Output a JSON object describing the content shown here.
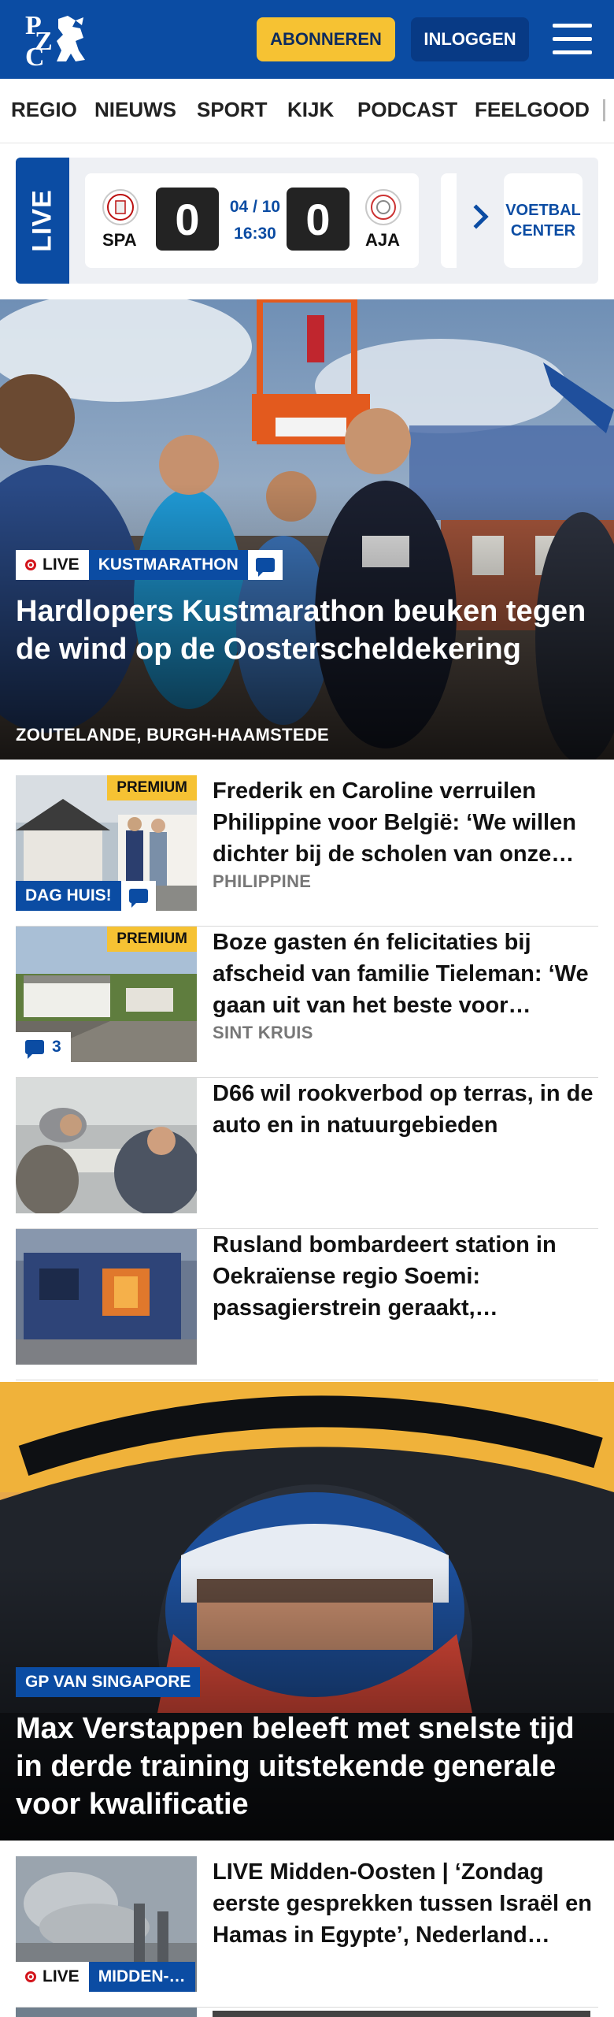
{
  "header": {
    "logo": [
      "P",
      "Z",
      "C"
    ],
    "subscribe_label": "ABONNEREN",
    "login_label": "INLOGGEN",
    "brand_color": "#0b4ca3",
    "accent_color": "#f6c233"
  },
  "nav": {
    "items": [
      "REGIO",
      "NIEUWS",
      "SPORT",
      "KIJK",
      "PODCAST",
      "FEELGOOD"
    ]
  },
  "livebar": {
    "live_label": "LIVE",
    "match": {
      "home": "SPA",
      "away": "AJA",
      "home_score": "0",
      "away_score": "0",
      "date": "04 / 10",
      "time": "16:30"
    },
    "voetbal_center_label": "VOETBAL\nCENTER"
  },
  "hero1": {
    "live_label": "LIVE",
    "category": "KUSTMARATHON",
    "title": "Hardlopers Kustmarathon beuken tegen de wind op de Oosterscheldeke­ring",
    "subtitle": "ZOUTELANDE, BURGH-HAAMSTEDE"
  },
  "articles": [
    {
      "title": "Frederik en Caroline verruilen Philippine voor België: ‘We willen dichter bij de scholen van onze…",
      "location": "PHILIPPINE",
      "premium": "PREMIUM",
      "label": "DAG HUIS!"
    },
    {
      "title": "Boze gasten én felicitaties bij afscheid van familie Tieleman: ‘We gaan uit van het beste voor…",
      "location": "SINT KRUIS",
      "premium": "PREMIUM",
      "comments": "3"
    },
    {
      "title": "D66 wil rookverbod op terras, in de auto en in natuurgebieden"
    },
    {
      "title": "Rusland bombardeert station in Oekraïense regio Soemi: passagierstrein geraakt,…"
    }
  ],
  "hero2": {
    "category": "GP VAN SINGAPORE",
    "title": "Max Verstappen beleeft met snelste tijd in derde training uitstekende generale voor kwalificatie"
  },
  "article_live": {
    "title": "LIVE Midden-Oosten | ‘Zondag eerste gesprekken tussen Israël en Hamas in Egypte’, Nederland…",
    "live_label": "LIVE",
    "category": "MIDDEN-…"
  }
}
